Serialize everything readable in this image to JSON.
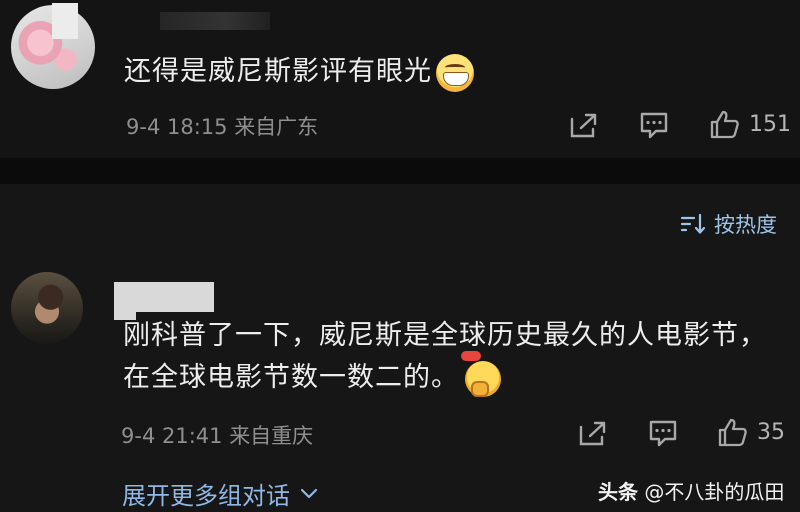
{
  "comments": [
    {
      "text": "还得是威尼斯影评有眼光",
      "timestamp": "9-4 18:15",
      "location": "来自广东",
      "likes": "151",
      "emoji": "grinning-face"
    },
    {
      "text": "刚科普了一下，威尼斯是全球历史最久的人电影节，在全球电影节数一数二的。",
      "timestamp": "9-4 21:41",
      "location": "来自重庆",
      "likes": "35",
      "emoji": "thinking-face"
    }
  ],
  "sort": {
    "label": "按热度"
  },
  "expand": {
    "label": "展开更多组对话"
  },
  "watermark": {
    "platform": "头条",
    "account": "@不八卦的瓜田"
  },
  "colors": {
    "background": "#161616",
    "link": "#8fb8e6",
    "meta": "#8f8f8f"
  }
}
